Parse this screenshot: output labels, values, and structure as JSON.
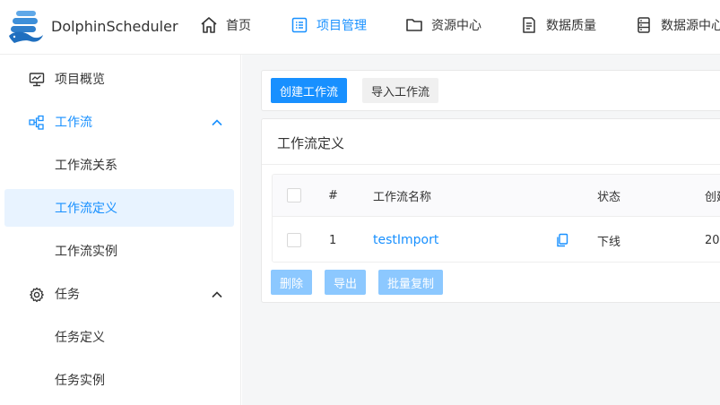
{
  "header": {
    "brand": "DolphinScheduler",
    "nav": [
      {
        "label": "首页",
        "icon": "home-icon"
      },
      {
        "label": "项目管理",
        "icon": "project-icon",
        "active": true
      },
      {
        "label": "资源中心",
        "icon": "folder-icon"
      },
      {
        "label": "数据质量",
        "icon": "document-icon"
      },
      {
        "label": "数据源中心",
        "icon": "database-icon"
      }
    ]
  },
  "sidebar": {
    "items": [
      {
        "label": "项目概览",
        "icon": "monitor-icon"
      },
      {
        "label": "工作流",
        "icon": "workflow-icon",
        "expanded": true
      },
      {
        "label": "工作流关系"
      },
      {
        "label": "工作流定义",
        "active": true
      },
      {
        "label": "工作流实例"
      },
      {
        "label": "任务",
        "icon": "gear-icon",
        "expanded": true
      },
      {
        "label": "任务定义"
      },
      {
        "label": "任务实例"
      }
    ]
  },
  "toolbar": {
    "create_label": "创建工作流",
    "import_label": "导入工作流"
  },
  "table_card": {
    "title": "工作流定义",
    "columns": [
      "#",
      "工作流名称",
      "状态",
      "创建"
    ],
    "rows": [
      {
        "index": "1",
        "name": "testImport",
        "status": "下线",
        "created": "20"
      }
    ],
    "actions": {
      "delete_label": "删除",
      "export_label": "导出",
      "batch_copy_label": "批量复制"
    }
  },
  "colors": {
    "accent": "#1890ff",
    "active_bg": "#e8f3ff",
    "disabled_btn": "#8cc8ff",
    "page_bg": "#f5f6f7"
  }
}
